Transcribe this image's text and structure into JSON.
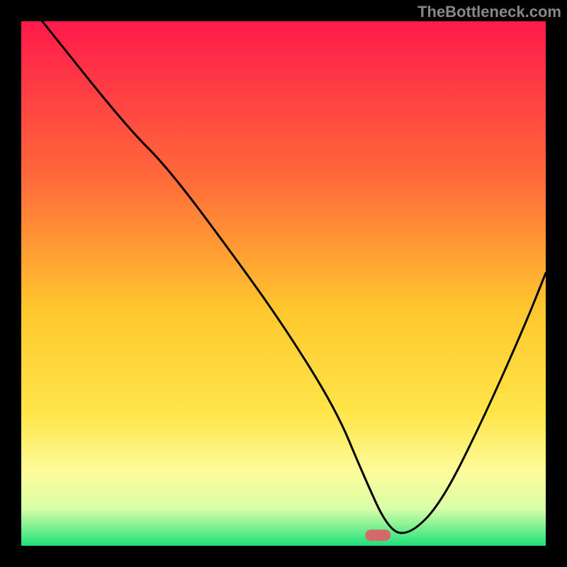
{
  "watermark": "TheBottleneck.com",
  "chart_data": {
    "type": "line",
    "title": "",
    "xlabel": "",
    "ylabel": "",
    "xlim": [
      0,
      100
    ],
    "ylim": [
      0,
      100
    ],
    "gradient_stops": [
      {
        "offset": 0,
        "color": "#ff1a4b"
      },
      {
        "offset": 30,
        "color": "#ff6a3a"
      },
      {
        "offset": 55,
        "color": "#ffc72e"
      },
      {
        "offset": 75,
        "color": "#ffe64a"
      },
      {
        "offset": 86,
        "color": "#fdfc9c"
      },
      {
        "offset": 93,
        "color": "#d8ffa8"
      },
      {
        "offset": 100,
        "color": "#1fe07a"
      }
    ],
    "marker": {
      "x": 68,
      "y": 2,
      "color": "#d26a6a"
    },
    "series": [
      {
        "name": "bottleneck-curve",
        "x": [
          4,
          20,
          28,
          40,
          50,
          60,
          65,
          70,
          74,
          80,
          88,
          96,
          100
        ],
        "values": [
          100,
          80,
          72,
          56,
          42,
          26,
          14,
          3,
          2,
          8,
          24,
          42,
          52
        ]
      }
    ]
  }
}
